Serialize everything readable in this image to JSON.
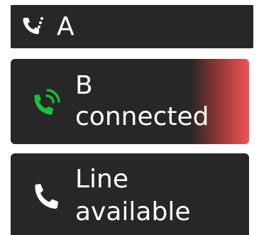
{
  "entries": [
    {
      "label": "A",
      "icon": "phone-dial-icon"
    },
    {
      "label": "B",
      "status": "connected",
      "icon": "phone-ringing-icon",
      "accent": "#14c43a",
      "alert_color": "#f15456"
    },
    {
      "label": "Line",
      "status": "available",
      "icon": "phone-icon"
    }
  ]
}
